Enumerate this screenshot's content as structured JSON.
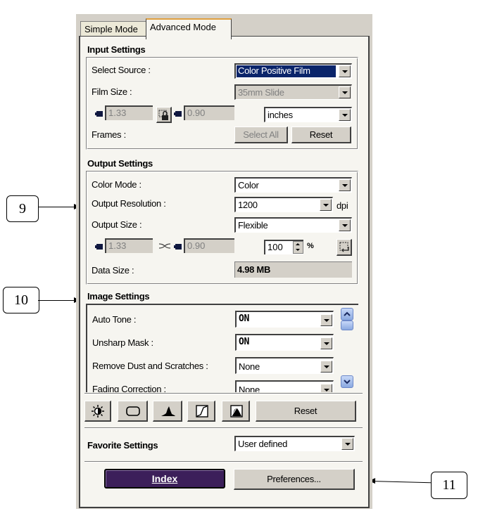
{
  "tabs": [
    {
      "label": "Simple Mode",
      "active": false
    },
    {
      "label": "Advanced Mode",
      "active": true
    }
  ],
  "input_settings": {
    "title": "Input Settings",
    "select_source": {
      "label": "Select Source :",
      "value": "Color Positive Film"
    },
    "film_size": {
      "label": "Film Size :",
      "value": "35mm Slide"
    },
    "width_value": "1.33",
    "height_value": "0.90",
    "units": "inches",
    "frames_label": "Frames :",
    "select_all_label": "Select All",
    "reset_label": "Reset"
  },
  "output_settings": {
    "title": "Output Settings",
    "color_mode": {
      "label": "Color Mode :",
      "value": "Color"
    },
    "output_resolution": {
      "label": "Output Resolution :",
      "value": "1200",
      "unit": "dpi"
    },
    "output_size": {
      "label": "Output Size :",
      "value": "Flexible"
    },
    "width_value": "1.33",
    "height_value": "0.90",
    "scale_value": "100",
    "scale_unit": "%",
    "data_size": {
      "label": "Data Size :",
      "value": "4.98 MB"
    }
  },
  "image_settings": {
    "title": "Image Settings",
    "items": [
      {
        "label": "Auto Tone :",
        "value": "ON"
      },
      {
        "label": "Unsharp Mask :",
        "value": "ON"
      },
      {
        "label": "Remove Dust and Scratches :",
        "value": "None"
      },
      {
        "label": "Fading Correction :",
        "value": "None"
      }
    ],
    "toolbar": {
      "icons": [
        "brightness-icon",
        "frame-icon",
        "histogram-icon",
        "tone-curve-icon",
        "histogram-curve-icon"
      ],
      "reset_label": "Reset"
    }
  },
  "favorite_settings": {
    "title": "Favorite Settings",
    "value": "User defined"
  },
  "footer": {
    "index_label": "Index",
    "preferences_label": "Preferences..."
  },
  "annotations": [
    {
      "number": "9",
      "target": "output-resolution"
    },
    {
      "number": "10",
      "target": "image-settings"
    },
    {
      "number": "11",
      "target": "preferences-button"
    }
  ]
}
